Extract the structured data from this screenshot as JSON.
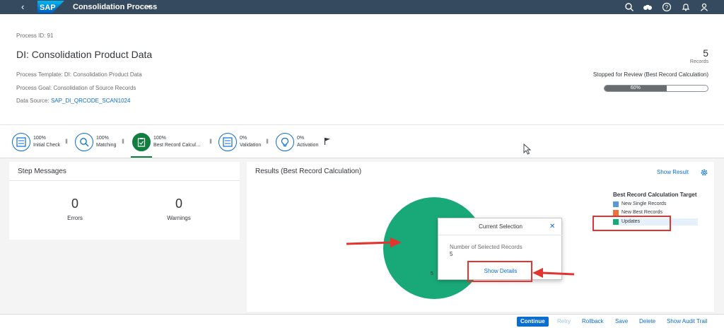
{
  "shell": {
    "back_icon": "back-chevron-icon",
    "logo": "SAP",
    "title": "Consolidation Process",
    "caret": "▾",
    "icons": [
      "search-icon",
      "binoculars-icon",
      "help-icon",
      "bell-icon",
      "user-icon"
    ]
  },
  "header": {
    "process_id": "Process ID: 91",
    "title": "DI: Consolidation Product Data",
    "template": "Process Template: DI: Consolidation Product Data",
    "goal": "Process Goal: Consolidation of Source Records",
    "data_source_label": "Data Source:",
    "data_source_link": "SAP_DI_QRCODE_SCAN1024",
    "kpi_value": "5",
    "kpi_label": "Records",
    "status": "Stopped for Review (Best Record Calculation)",
    "progress_text": "60%",
    "progress_value": 60
  },
  "steps": [
    {
      "pct": "100%",
      "label": "Initial Check",
      "icon": "checklist-icon"
    },
    {
      "pct": "100%",
      "label": "Matching",
      "icon": "magnifier-icon"
    },
    {
      "pct": "100%",
      "label": "Best Record Calcul…",
      "icon": "clipboard-icon"
    },
    {
      "pct": "0%",
      "label": "Validation",
      "icon": "checklist-icon"
    },
    {
      "pct": "0%",
      "label": "Activation",
      "icon": "lightbulb-icon"
    }
  ],
  "step_separator": "II",
  "step_end_icon": "flag-icon",
  "step_messages": {
    "title": "Step Messages",
    "errors_value": "0",
    "errors_label": "Errors",
    "warnings_value": "0",
    "warnings_label": "Warnings"
  },
  "results": {
    "title": "Results (Best Record Calculation)",
    "show_result": "Show Result",
    "settings_icon": "gear-icon"
  },
  "legend": {
    "title": "Best Record Calculation Target",
    "items": [
      {
        "label": "New Single Records",
        "color": "#5899da"
      },
      {
        "label": "New Best Records",
        "color": "#e8743b"
      },
      {
        "label": "Updates",
        "color": "#19a979"
      }
    ]
  },
  "chart_data": {
    "type": "pie",
    "slices": [
      {
        "label": "New Single Records",
        "value": 0,
        "color": "#5899da"
      },
      {
        "label": "New Best Records",
        "value": 0,
        "color": "#e8743b"
      },
      {
        "label": "Updates",
        "value": 5,
        "color": "#19a979"
      }
    ],
    "data_label": "5",
    "legend_title": "Best Record Calculation Target",
    "legend_position": "right"
  },
  "popover": {
    "title": "Current Selection",
    "close": "✕",
    "label": "Number of Selected Records",
    "value": "5",
    "button": "Show Details"
  },
  "footer": {
    "continue": "Continue",
    "retry": "Retry",
    "rollback": "Rollback",
    "save": "Save",
    "delete": "Delete",
    "audit": "Show Audit Trail"
  },
  "colors": {
    "shell": "#354a5f",
    "brand": "#0a6ed1",
    "active_step": "#107e3e",
    "annotation": "#e3342f"
  }
}
